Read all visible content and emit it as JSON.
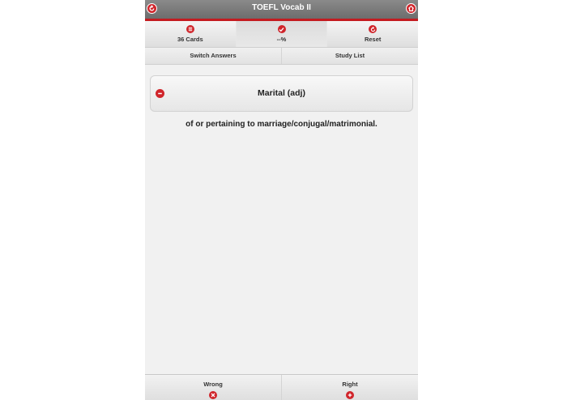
{
  "app": {
    "title": "TOEFL Vocab II",
    "back_icon": "back-arrow-icon",
    "home_icon": "home-icon",
    "accent_color": "#d0252b"
  },
  "toolbar": {
    "buttons": [
      {
        "label": "36 Cards",
        "icon": "list-icon"
      },
      {
        "label": "--%",
        "icon": "checkmark-icon"
      },
      {
        "label": "Reset",
        "icon": "refresh-icon"
      }
    ]
  },
  "subbar": {
    "switch_label": "Switch Answers",
    "study_list_label": "Study List"
  },
  "card": {
    "word": "Marital (adj)",
    "icon": "minus-icon"
  },
  "definition": "of or pertaining to marriage/conjugal/matrimonial.",
  "bottombar": {
    "wrong_label": "Wrong",
    "wrong_icon": "close-icon",
    "right_label": "Right",
    "right_icon": "plus-icon"
  }
}
